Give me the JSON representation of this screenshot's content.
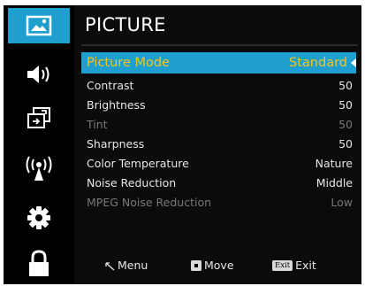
{
  "sidebar": {
    "items": [
      {
        "icon": "picture-icon",
        "active": true
      },
      {
        "icon": "sound-icon",
        "active": false
      },
      {
        "icon": "input-source-icon",
        "active": false
      },
      {
        "icon": "broadcast-antenna-icon",
        "active": false
      },
      {
        "icon": "settings-gear-icon",
        "active": false
      },
      {
        "icon": "lock-icon",
        "active": false
      }
    ]
  },
  "menu": {
    "title": "PICTURE",
    "rows": [
      {
        "label": "Picture Mode",
        "value": "Standard"
      },
      {
        "label": "Contrast",
        "value": "50"
      },
      {
        "label": "Brightness",
        "value": "50"
      },
      {
        "label": "Tint",
        "value": "50"
      },
      {
        "label": "Sharpness",
        "value": "50"
      },
      {
        "label": "Color Temperature",
        "value": "Nature"
      },
      {
        "label": "Noise Reduction",
        "value": "Middle"
      },
      {
        "label": "MPEG Noise Reduction",
        "value": "Low"
      }
    ]
  },
  "footer": {
    "menu_label": "Menu",
    "move_label": "Move",
    "exit_key": "Exit",
    "exit_label": "Exit"
  },
  "colors": {
    "accent": "#1f9fd0",
    "selected_text": "#f5c518",
    "background": "#000000",
    "disabled_text": "#777777"
  }
}
